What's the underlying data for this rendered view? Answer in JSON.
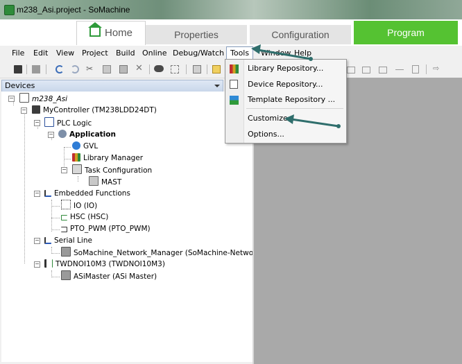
{
  "window": {
    "title": "m238_Asi.project - SoMachine"
  },
  "ribbon": {
    "tabs": [
      {
        "label": "Home"
      },
      {
        "label": "Properties"
      },
      {
        "label": "Configuration"
      },
      {
        "label": "Program"
      }
    ]
  },
  "menubar": {
    "items": [
      "File",
      "Edit",
      "View",
      "Project",
      "Build",
      "Online",
      "Debug/Watch",
      "Tools",
      "Window",
      "Help"
    ]
  },
  "tools_menu": {
    "items": [
      {
        "label": "Library Repository...",
        "icon": "library-icon"
      },
      {
        "label": "Device Repository...",
        "icon": "device-icon"
      },
      {
        "label": "Template Repository ...",
        "icon": "template-icon"
      },
      {
        "label": "Customize...",
        "icon": ""
      },
      {
        "label": "Options...",
        "icon": ""
      }
    ]
  },
  "devices_panel": {
    "title": "Devices",
    "tree": [
      {
        "label": "m238_Asi",
        "icon": "project-icon"
      },
      {
        "label": "MyController (TM238LDD24DT)",
        "icon": "controller-icon"
      },
      {
        "label": "PLC Logic",
        "icon": "plc-logic-icon"
      },
      {
        "label": "Application",
        "icon": "application-gear-icon"
      },
      {
        "label": "GVL",
        "icon": "globe-icon"
      },
      {
        "label": "Library Manager",
        "icon": "library-icon"
      },
      {
        "label": "Task Configuration",
        "icon": "task-config-icon"
      },
      {
        "label": "MAST",
        "icon": "task-icon"
      },
      {
        "label": "Embedded Functions",
        "icon": "embedded-functions-icon"
      },
      {
        "label": "IO (IO)",
        "icon": "io-icon"
      },
      {
        "label": "HSC (HSC)",
        "icon": "hsc-icon"
      },
      {
        "label": "PTO_PWM (PTO_PWM)",
        "icon": "pto-pwm-icon"
      },
      {
        "label": "Serial Line",
        "icon": "serial-line-icon"
      },
      {
        "label": "SoMachine_Network_Manager (SoMachine-Networ",
        "icon": "network-manager-icon"
      },
      {
        "label": "TWDNOI10M3 (TWDNOI10M3)",
        "icon": "module-icon"
      },
      {
        "label": "ASiMaster (ASi Master)",
        "icon": "asi-master-icon"
      }
    ]
  },
  "colors": {
    "program_tab": "#55c232",
    "editor_background": "#a9a9a9",
    "annotation_arrow": "#2f6e6c"
  }
}
